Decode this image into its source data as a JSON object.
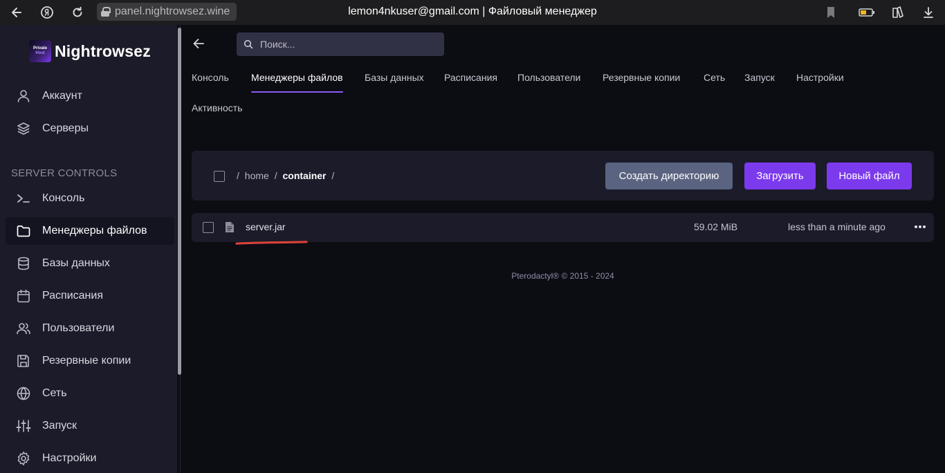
{
  "browser": {
    "url": "panel.nightrowsez.wine",
    "tab_title": "lemon4nkuser@gmail.com | Файловый менеджер"
  },
  "brand": {
    "logo_line1": "Private",
    "logo_line2": "Host",
    "name": "Nightrowsez"
  },
  "sidebar": {
    "top_items": [
      {
        "label": "Аккаунт",
        "icon": "user-icon"
      },
      {
        "label": "Серверы",
        "icon": "layers-icon"
      }
    ],
    "section_title": "SERVER CONTROLS",
    "items": [
      {
        "label": "Консоль",
        "icon": "terminal-icon"
      },
      {
        "label": "Менеджеры файлов",
        "icon": "folder-icon"
      },
      {
        "label": "Базы данных",
        "icon": "database-icon"
      },
      {
        "label": "Расписания",
        "icon": "calendar-icon"
      },
      {
        "label": "Пользователи",
        "icon": "users-icon"
      },
      {
        "label": "Резервные копии",
        "icon": "save-icon"
      },
      {
        "label": "Сеть",
        "icon": "globe-icon"
      },
      {
        "label": "Запуск",
        "icon": "sliders-icon"
      },
      {
        "label": "Настройки",
        "icon": "gear-icon"
      }
    ]
  },
  "search": {
    "placeholder": "Поиск..."
  },
  "tabs": [
    "Консоль",
    "Менеджеры файлов",
    "Базы данных",
    "Расписания",
    "Пользователи",
    "Резервные копии",
    "Сеть",
    "Запуск",
    "Настройки",
    "Активность"
  ],
  "breadcrumb": {
    "sep": "/",
    "home": "home",
    "current": "container"
  },
  "actions": {
    "create_dir": "Создать директорию",
    "upload": "Загрузить",
    "new_file": "Новый файл"
  },
  "files": [
    {
      "name": "server.jar",
      "size": "59.02 MiB",
      "modified": "less than a minute ago"
    }
  ],
  "footer": "Pterodactyl® © 2015 - 2024",
  "colors": {
    "accent": "#7c3aed",
    "annotation": "#d9433a"
  }
}
